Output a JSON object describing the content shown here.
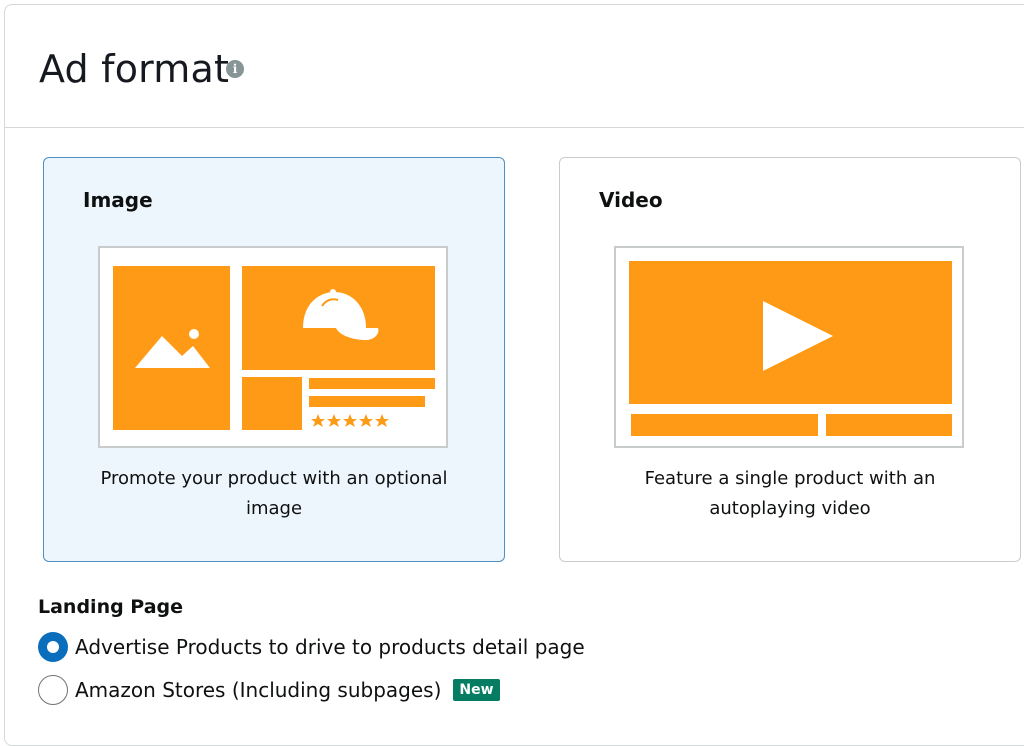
{
  "header": {
    "title": "Ad format",
    "info_icon": "info-icon"
  },
  "cards": [
    {
      "title": "Image",
      "description": "Promote your product with an optional image",
      "selected": true,
      "icon": "image-ad-illustration"
    },
    {
      "title": "Video",
      "description": "Feature a single product with an autoplaying video",
      "selected": false,
      "icon": "video-ad-illustration"
    }
  ],
  "landing_page": {
    "label": "Landing Page",
    "options": [
      {
        "label": "Advertise Products to drive to products detail page",
        "selected": true
      },
      {
        "label": "Amazon Stores (Including subpages)",
        "selected": false,
        "badge": "New"
      }
    ]
  },
  "colors": {
    "accent_orange": "#ff9a16",
    "selected_bg": "#edf6fd",
    "selected_border": "#4d90c6",
    "radio_blue": "#0a6ebd",
    "badge_green": "#067d62"
  }
}
